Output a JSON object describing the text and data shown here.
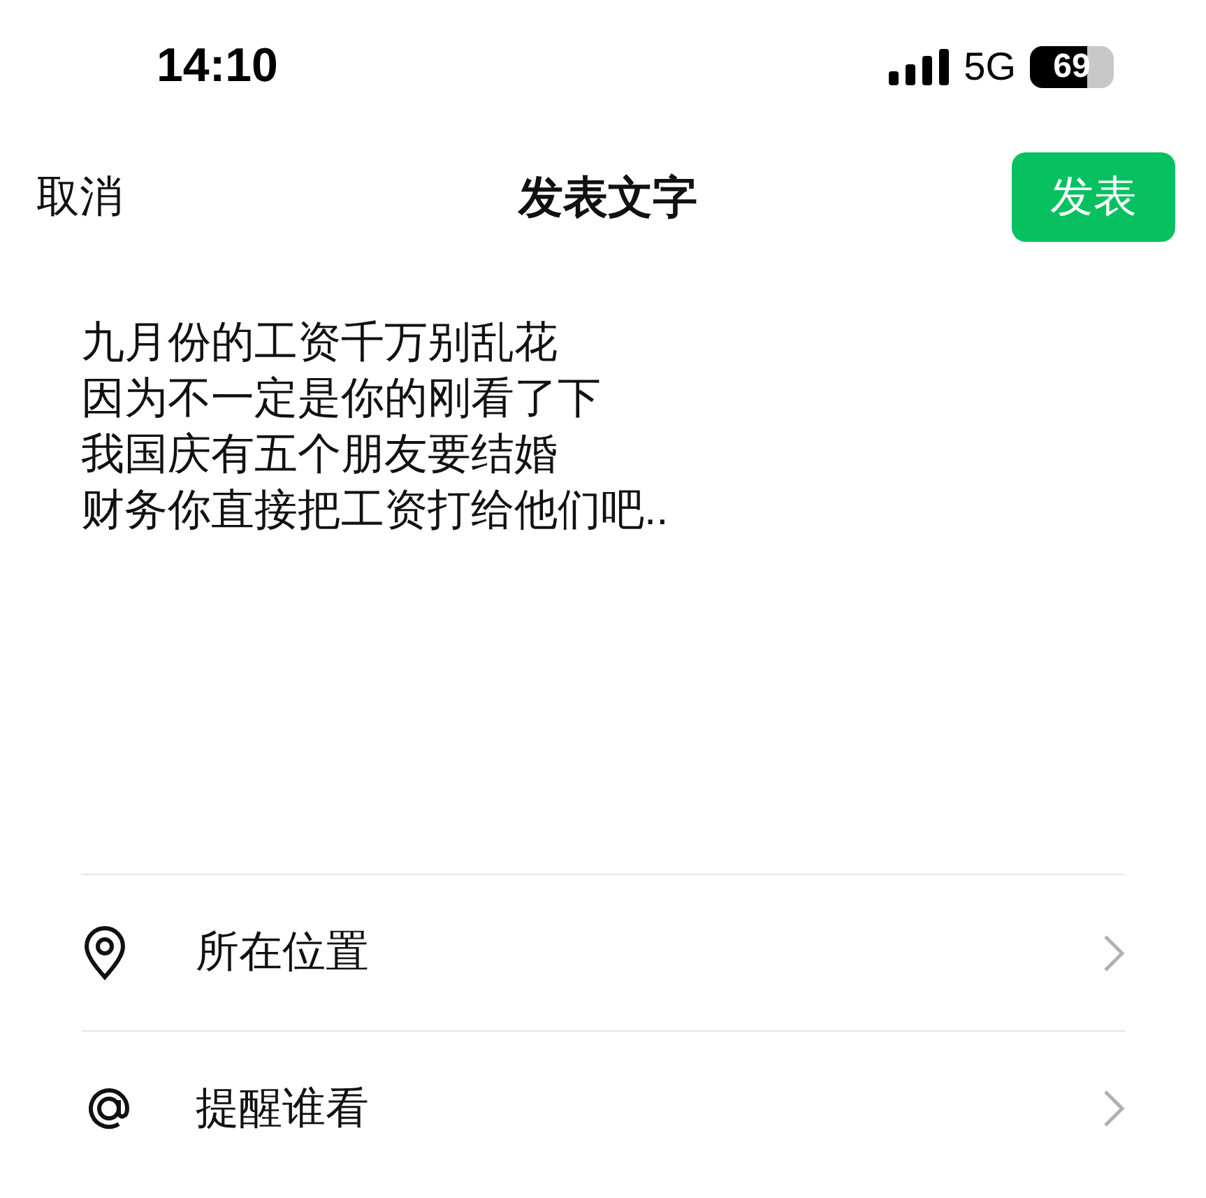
{
  "status_bar": {
    "time": "14:10",
    "network": "5G",
    "battery": "69"
  },
  "header": {
    "cancel": "取消",
    "title": "发表文字",
    "publish": "发表"
  },
  "post_text": [
    "九月份的工资千万别乱花",
    "因为不一定是你的刚看了下",
    "我国庆有五个朋友要结婚",
    "财务你直接把工资打给他们吧.."
  ],
  "options": [
    {
      "kind": "location",
      "label": "所在位置"
    },
    {
      "kind": "mention",
      "label": "提醒谁看"
    }
  ]
}
